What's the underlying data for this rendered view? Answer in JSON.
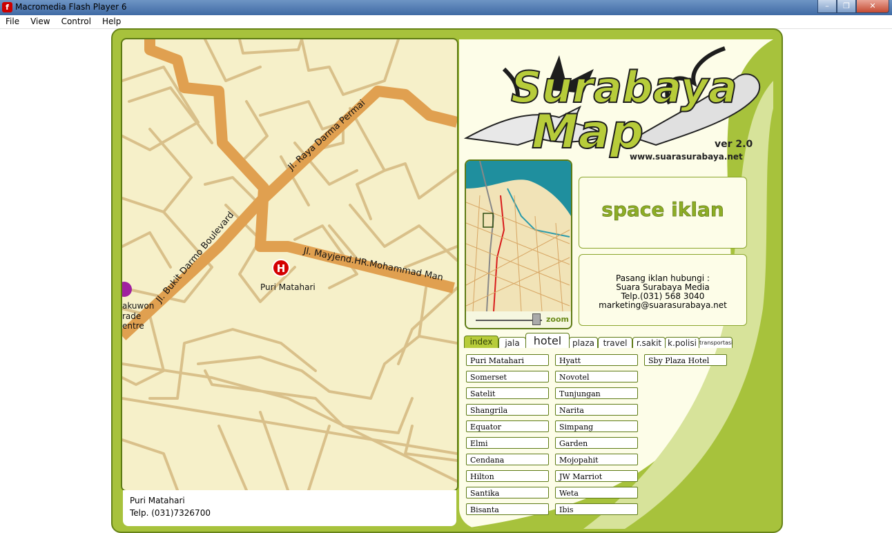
{
  "window": {
    "title": "Macromedia Flash Player 6",
    "min": "–",
    "max": "❐",
    "close": "✕"
  },
  "menu": [
    "File",
    "View",
    "Control",
    "Help"
  ],
  "map": {
    "roads": [
      "Jl. Raya Darma Permai",
      "Jl. Bukit Darmo Boulevard",
      "Jl. Mayjend.HR.Mohammad Man"
    ],
    "hotel_marker": "H",
    "hotel_label": "Puri Matahari",
    "poi_label": [
      "akuwon",
      "rade",
      "entre"
    ]
  },
  "info": {
    "name": "Puri Matahari",
    "phone": "Telp. (031)7326700"
  },
  "logo": {
    "word1": "Surabaya",
    "word2": "Map",
    "version": "ver 2.0",
    "site": "www.suarasurabaya.net"
  },
  "zoom_label": "zoom",
  "ad": {
    "text": "space iklan",
    "contact": [
      "Pasang iklan hubungi :",
      "Suara Surabaya Media",
      "Telp.(031) 568 3040",
      "marketing@suarasurabaya.net"
    ]
  },
  "tabs": [
    "index",
    "jala",
    "hotel",
    "plaza",
    "travel",
    "r.sakit",
    "k.polisi",
    "transportasi"
  ],
  "hotels": {
    "col1": [
      "Puri Matahari",
      "Somerset",
      "Satelit",
      "Shangrila",
      "Equator",
      "Elmi",
      "Cendana",
      "Hilton",
      "Santika",
      "Bisanta"
    ],
    "col2": [
      "Hyatt",
      "Novotel",
      "Tunjungan",
      "Narita",
      "Simpang",
      "Garden",
      "Mojopahit",
      "JW Marriot",
      "Weta",
      "Ibis"
    ],
    "col3": [
      "Sby Plaza Hotel"
    ]
  },
  "colors": {
    "frame": "#a7c23c",
    "panel": "#fdfde8",
    "map_bg": "#f6f0c9",
    "road": "#e0a050",
    "street": "#d9c08a"
  }
}
